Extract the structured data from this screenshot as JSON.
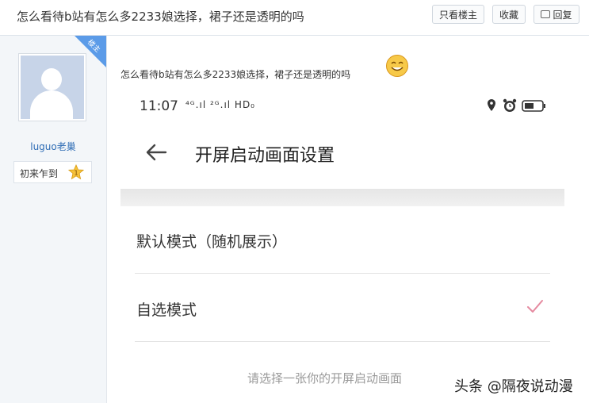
{
  "header": {
    "title": "怎么看待b站有怎么多2233娘选择，裙子还是透明的吗",
    "buttons": {
      "only_author": "只看楼主",
      "favorite": "收藏",
      "reply": "回复"
    }
  },
  "author": {
    "badge": "楼主",
    "username": "luguo老巢",
    "rank": "初来乍到",
    "rank_level": "1"
  },
  "post": {
    "text": "怎么看待b站有怎么多2233娘选择，裙子还是透明的吗",
    "emoji": "smiley-icon",
    "screenshot": {
      "time": "11:07",
      "network": "⁴ᴳ.ıl ²ᴳ.ıl HD₀",
      "page_title": "开屏启动画面设置",
      "options": [
        {
          "label": "默认模式（随机展示）",
          "selected": false
        },
        {
          "label": "自选模式",
          "selected": true
        }
      ],
      "hint": "请选择一张你的开屏启动画面"
    }
  },
  "watermark": "头条 @隔夜说动漫",
  "colors": {
    "accent_blue": "#5b9be8",
    "check_pink": "#e58aa0",
    "username_blue": "#2f6db5"
  }
}
